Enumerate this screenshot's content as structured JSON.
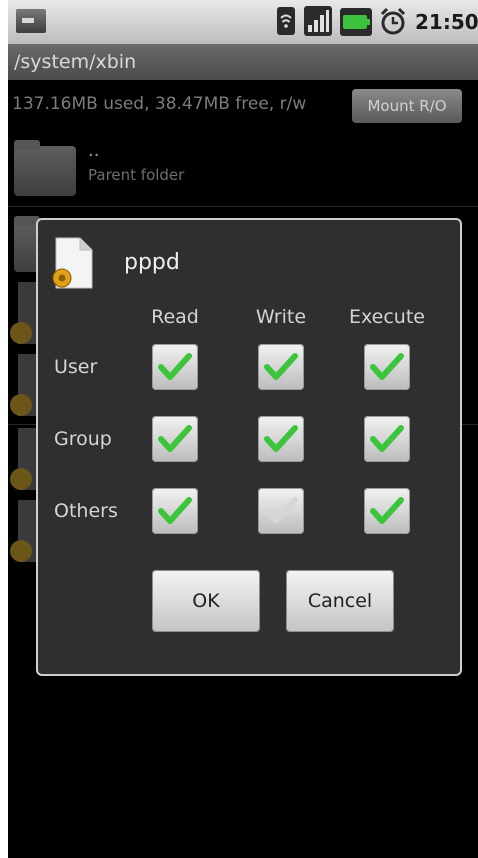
{
  "status_bar": {
    "time": "21:50",
    "icons": [
      "app-notification-icon",
      "wifi-icon",
      "signal-icon",
      "battery-icon",
      "alarm-icon"
    ]
  },
  "path": "/system/xbin",
  "storage": {
    "info": "137.16MB used, 38.47MB free, r/w",
    "mount_button": "Mount R/O"
  },
  "file_list": {
    "items": [
      {
        "name": "..",
        "subtitle": "Parent folder"
      }
    ]
  },
  "dialog": {
    "filename": "pppd",
    "columns": [
      "Read",
      "Write",
      "Execute"
    ],
    "rows": [
      {
        "label": "User",
        "read": true,
        "write": true,
        "execute": true
      },
      {
        "label": "Group",
        "read": true,
        "write": true,
        "execute": true
      },
      {
        "label": "Others",
        "read": true,
        "write": false,
        "execute": true
      }
    ],
    "ok_label": "OK",
    "cancel_label": "Cancel"
  },
  "colors": {
    "check_green": "#3cc43c",
    "check_disabled": "#d6d6d6",
    "dialog_bg": "#2f2f2f"
  }
}
